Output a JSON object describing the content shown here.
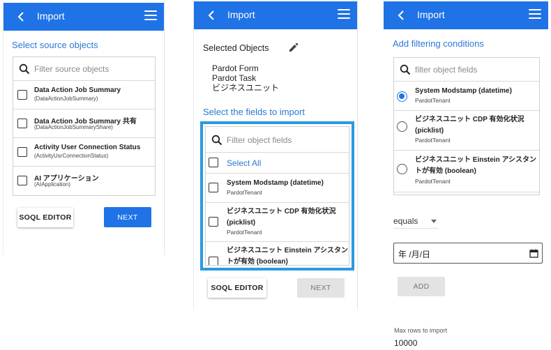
{
  "colors": {
    "appbar": "#1f73e6",
    "link": "#2b78d6",
    "highlight_border": "#2a9be0"
  },
  "screen1": {
    "header_title": "Import",
    "section_title": "Select source objects",
    "search_placeholder": "Filter source objects",
    "objects": [
      {
        "name": "Data Action Job Summary",
        "api": "(DataActionJobSummary)"
      },
      {
        "name": "Data Action Job Summary 共有",
        "api": "(DataActionJobSummaryShare)"
      },
      {
        "name": "Activity User Connection Status",
        "api": "(ActivityUsrConnectionStatus)"
      },
      {
        "name": "AI アプリケーション",
        "api": "(AIApplication)"
      }
    ],
    "soql_button": "SOQL EDITOR",
    "next_button": "NEXT"
  },
  "screen2": {
    "header_title": "Import",
    "selected_label": "Selected Objects",
    "selected_objects": [
      "Pardot Form",
      "Pardot Task",
      "ビジネスユニット"
    ],
    "fields_title": "Select the fields to import",
    "search_placeholder": "Filter object fields",
    "select_all": "Select All",
    "fields": [
      {
        "name": "System Modstamp (datetime)",
        "sub": "PardotTenant"
      },
      {
        "name": "ビジネスユニット CDP 有効化状況 (picklist)",
        "sub": "PardotTenant"
      },
      {
        "name": "ビジネスユニット Einstein アシスタントが有効 (boolean)",
        "sub": ""
      }
    ],
    "soql_button": "SOQL EDITOR",
    "next_button": "NEXT"
  },
  "screen3": {
    "header_title": "Import",
    "section_title": "Add filtering conditions",
    "search_placeholder": "filter object fields",
    "conditions": [
      {
        "name": "System Modstamp (datetime)",
        "sub": "PardotTenant",
        "checked": true
      },
      {
        "name": "ビジネスユニット CDP 有効化状況 (picklist)",
        "sub": "PardotTenant",
        "checked": false
      },
      {
        "name": "ビジネスユニット Einstein アシスタントが有効 (boolean)",
        "sub": "PardotTenant",
        "checked": false
      }
    ],
    "operator": "equals",
    "date_value": "年 /月/日",
    "add_button": "ADD",
    "max_rows_label": "Max rows to import",
    "max_rows_value": "10000"
  }
}
